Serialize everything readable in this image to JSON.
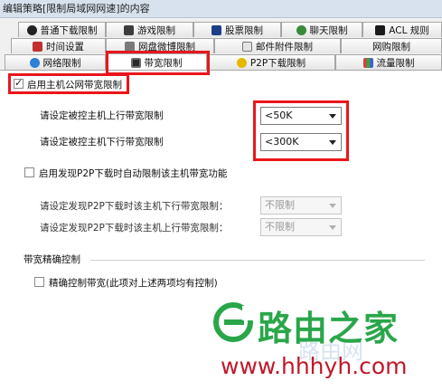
{
  "window": {
    "title": "编辑策略[限制局域网网速]的内容"
  },
  "tabs": {
    "row1": [
      {
        "label": "普通下载限制"
      },
      {
        "label": "游戏限制"
      },
      {
        "label": "股票限制"
      },
      {
        "label": "聊天限制"
      },
      {
        "label": "ACL 规则"
      }
    ],
    "row2": [
      {
        "label": "时间设置"
      },
      {
        "label": "网盘微博限制"
      },
      {
        "label": "邮件附件限制"
      },
      {
        "label": "网购限制"
      }
    ],
    "row3": [
      {
        "label": "网络限制"
      },
      {
        "label": "带宽限制"
      },
      {
        "label": "P2P下载限制"
      },
      {
        "label": "流量限制"
      }
    ]
  },
  "bandwidth": {
    "enable_label": "启用主机公网带宽限制",
    "enabled": true,
    "upload_label": "请设定被控主机上行带宽限制",
    "upload_value": "<50K",
    "download_label": "请设定被控主机下行带宽限制",
    "download_value": "<300K"
  },
  "p2p": {
    "enable_label": "启用发现P2P下载时自动限制该主机带宽功能",
    "enabled": false,
    "download_label": "请设定发现P2P下载时该主机下行带宽限制：",
    "download_value": "不限制",
    "upload_label": "请设定发现P2P下载时该主机上行带宽限制：",
    "upload_value": "不限制"
  },
  "precise": {
    "group_title": "带宽精确控制",
    "checkbox_label": "精确控制带宽(此项对上述两项均有控制)",
    "enabled": false
  },
  "watermark": {
    "brand": "路由之家",
    "url": "www.hhhyh.com",
    "faint_text": "路由网",
    "brand_color": "#2aa64a",
    "url_color": "#c0182a"
  },
  "colors": {
    "highlight": "#e8161c"
  }
}
